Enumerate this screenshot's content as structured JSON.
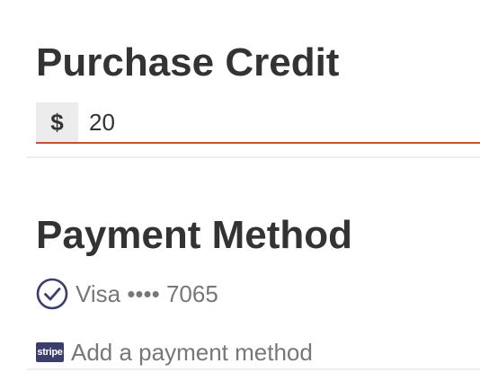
{
  "purchase": {
    "title": "Purchase Credit",
    "currency_symbol": "$",
    "amount_value": "20"
  },
  "payment": {
    "title": "Payment Method",
    "selected_card": {
      "label": "Visa •••• 7065",
      "icon": "check-circle-icon"
    },
    "add_method": {
      "badge": "stripe",
      "label": "Add a payment method",
      "icon": "stripe-icon"
    }
  },
  "colors": {
    "text": "#333333",
    "muted_text": "#777777",
    "input_underline": "#c9512f",
    "addon_background": "#ececec",
    "check_icon": "#3d3d6b",
    "stripe_badge": "#3d3d6b"
  }
}
